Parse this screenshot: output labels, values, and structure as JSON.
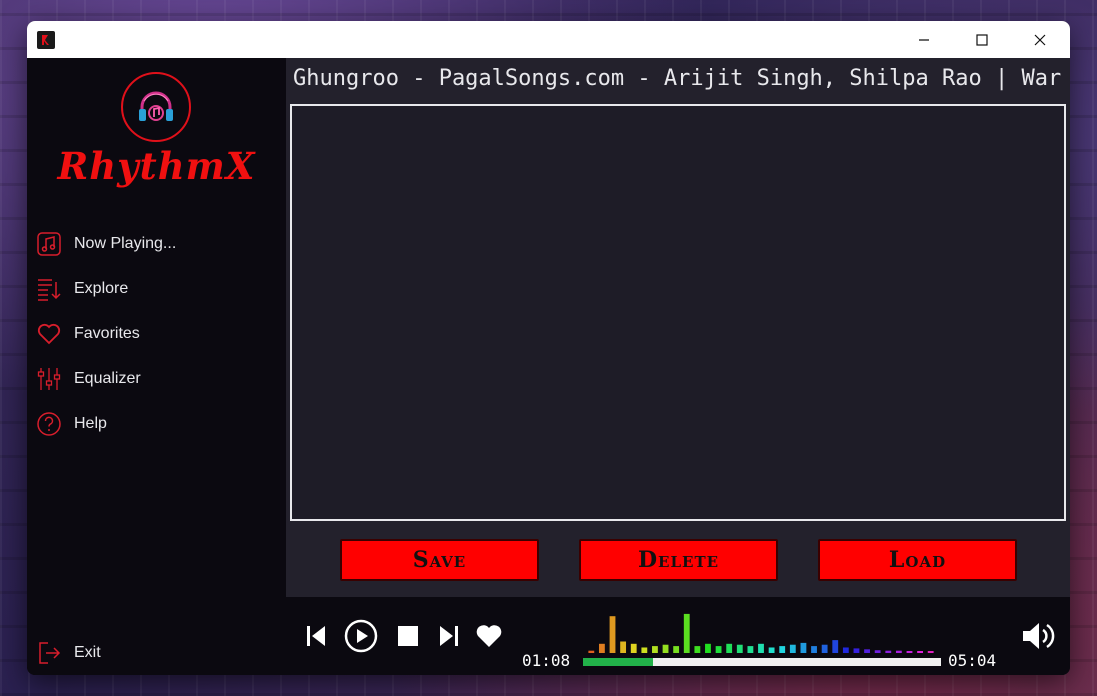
{
  "window": {
    "app_icon": "rhythmx-app-icon",
    "controls": [
      "minimize-icon",
      "maximize-icon",
      "close-icon"
    ]
  },
  "sidebar": {
    "logo_text": "RhythmX",
    "logo_icon": "headphones-icon",
    "items": [
      {
        "label": "Now Playing...",
        "icon": "music-note-icon"
      },
      {
        "label": "Explore",
        "icon": "playlist-icon"
      },
      {
        "label": "Favorites",
        "icon": "heart-outline-icon"
      },
      {
        "label": "Equalizer",
        "icon": "sliders-icon"
      },
      {
        "label": "Help",
        "icon": "help-icon"
      }
    ],
    "exit_label": "Exit",
    "exit_icon": "exit-icon"
  },
  "main": {
    "now_playing_text": "Ghungroo - PagalSongs.com - Arijit Singh, Shilpa Rao | War",
    "buttons": {
      "save": "Save",
      "delete": "Delete",
      "load": "Load"
    }
  },
  "player": {
    "current_time": "01:08",
    "total_time": "05:04",
    "progress_fraction": 0.195,
    "controls": [
      "previous-icon",
      "play-icon",
      "stop-icon",
      "next-icon",
      "heart-icon",
      "volume-icon"
    ],
    "spectrum_levels": [
      0.05,
      0.2,
      0.8,
      0.25,
      0.2,
      0.12,
      0.15,
      0.18,
      0.15,
      0.85,
      0.15,
      0.2,
      0.15,
      0.2,
      0.18,
      0.15,
      0.2,
      0.12,
      0.15,
      0.18,
      0.22,
      0.15,
      0.18,
      0.28,
      0.12,
      0.1,
      0.08,
      0.06,
      0.05,
      0.05,
      0.04,
      0.04,
      0.03
    ],
    "colors": {
      "accent": "#ff0000",
      "progress": "#22b24a"
    }
  }
}
